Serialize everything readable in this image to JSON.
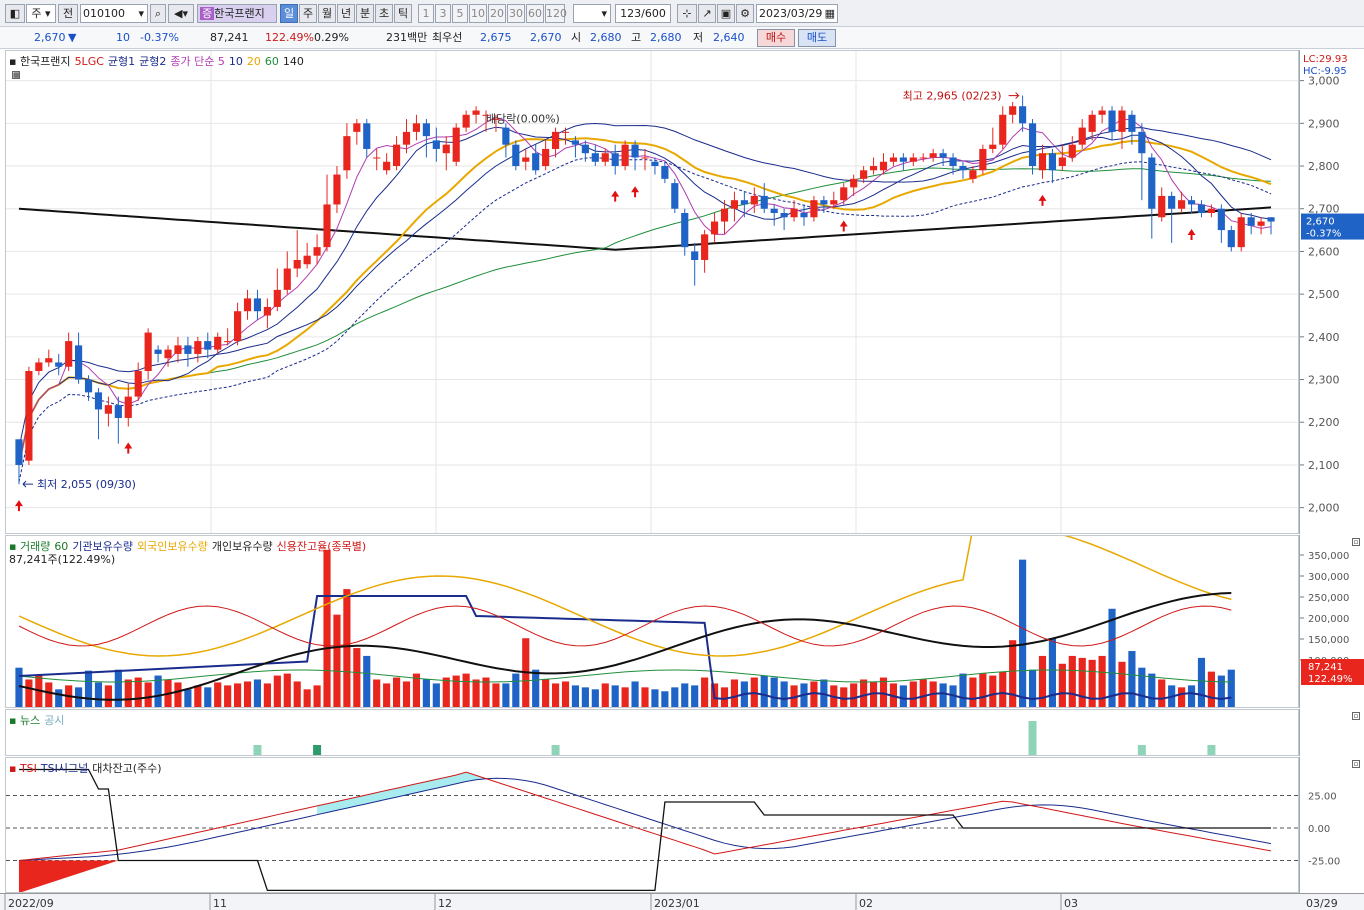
{
  "toolbar": {
    "period_label": "주",
    "prev_label": "전",
    "code_value": "010100",
    "stock_name": "한국프랜지",
    "chart_types": [
      "일",
      "주",
      "월",
      "년",
      "분",
      "초",
      "틱"
    ],
    "intervals": [
      "1",
      "3",
      "5",
      "10",
      "20",
      "30",
      "60",
      "120"
    ],
    "count_value": "123",
    "count_total": "/600",
    "date_value": "2023/03/29"
  },
  "quote": {
    "price": "2,670",
    "direction": "▼",
    "change": "10",
    "change_rate": "-0.37%",
    "volume": "87,241",
    "volume_ratio": "122.49%",
    "turnover_rate": "0.29%",
    "trade_amount": "231백만",
    "best_ask_label": "최우선",
    "best_ask": "2,675",
    "best_bid": "2,670",
    "open_label": "시",
    "open": "2,680",
    "high_label": "고",
    "high": "2,680",
    "low_label": "저",
    "low": "2,640",
    "buy_label": "매수",
    "sell_label": "매도"
  },
  "main_pane": {
    "legend": [
      {
        "text": "한국프랜지",
        "color": "#222222"
      },
      {
        "text": "5LGC",
        "color": "#d01818"
      },
      {
        "text": "균형1",
        "color": "#1a2c8c"
      },
      {
        "text": "균형2",
        "color": "#1a2c8c"
      },
      {
        "text": "종가 단순 5",
        "color": "#b23cb2"
      },
      {
        "text": "10",
        "color": "#1a2c8c"
      },
      {
        "text": "20",
        "color": "#e8a800"
      },
      {
        "text": "60",
        "color": "#1f8f3a"
      },
      {
        "text": "140",
        "color": "#222222"
      }
    ],
    "annotations": {
      "high": "최고 2,965 (02/23)",
      "low": "최저 2,055 (09/30)",
      "dividend": "배당락(0.00%)"
    },
    "lc_label": "LC:29.93",
    "hc_label": "HC:-9.95",
    "price_ticks": [
      "3,000",
      "2,900",
      "2,800",
      "2,700",
      "2,600",
      "2,500",
      "2,400",
      "2,300",
      "2,200",
      "2,100",
      "2,000"
    ],
    "current_price_tag": "2,670",
    "current_rate_tag": "-0.37%"
  },
  "volume_pane": {
    "legend": [
      {
        "text": "거래량",
        "color": "#1a7a2a"
      },
      {
        "text": "60",
        "color": "#1a7a2a"
      },
      {
        "text": "기관보유수량",
        "color": "#1a2c8c"
      },
      {
        "text": "외국인보유수량",
        "color": "#e8a800"
      },
      {
        "text": "개인보유수량",
        "color": "#222222"
      },
      {
        "text": "신용잔고율(종목별)",
        "color": "#d01818"
      }
    ],
    "sub_label": "87,241주(122.49%)",
    "ticks": [
      "350,000",
      "300,000",
      "250,000",
      "200,000",
      "150,000",
      "100,000"
    ],
    "current_volume_tag": "87,241",
    "current_ratio_tag": "122.49%"
  },
  "news_pane": {
    "legend": [
      {
        "text": "뉴스",
        "color": "#1a7a2a"
      },
      {
        "text": "공시",
        "color": "#7ab"
      }
    ]
  },
  "tsi_pane": {
    "legend": [
      {
        "text": "TSI",
        "color": "#d01818"
      },
      {
        "text": "TSI시그널",
        "color": "#1a2c8c"
      },
      {
        "text": "대차잔고(주수)",
        "color": "#222222"
      }
    ],
    "ticks": [
      "25.00",
      "0.00",
      "-25.00"
    ]
  },
  "time_axis": {
    "labels": [
      "2022/09",
      "11",
      "12",
      "2023/01",
      "02",
      "03"
    ],
    "end_label": "03/29"
  },
  "colors": {
    "up": "#e8261e",
    "down": "#1f63c6",
    "ma5": "#b23cb2",
    "ma10": "#1a2c8c",
    "ma20": "#e8a800",
    "ma60": "#1f8f3a",
    "ma140": "#111111"
  },
  "chart_data": {
    "type": "candlestick",
    "price_range": [
      1950,
      3060
    ],
    "candles": [
      [
        2160,
        2100,
        2160,
        2055
      ],
      [
        2110,
        2320,
        2330,
        2100
      ],
      [
        2320,
        2340,
        2350,
        2310
      ],
      [
        2340,
        2350,
        2370,
        2330
      ],
      [
        2340,
        2330,
        2360,
        2310
      ],
      [
        2330,
        2390,
        2410,
        2320
      ],
      [
        2380,
        2300,
        2410,
        2290
      ],
      [
        2300,
        2270,
        2310,
        2250
      ],
      [
        2270,
        2230,
        2280,
        2160
      ],
      [
        2220,
        2240,
        2260,
        2190
      ],
      [
        2240,
        2210,
        2260,
        2150
      ],
      [
        2210,
        2260,
        2290,
        2190
      ],
      [
        2260,
        2320,
        2340,
        2250
      ],
      [
        2320,
        2410,
        2420,
        2300
      ],
      [
        2370,
        2360,
        2380,
        2340
      ],
      [
        2350,
        2370,
        2380,
        2330
      ],
      [
        2360,
        2380,
        2400,
        2340
      ],
      [
        2380,
        2360,
        2400,
        2330
      ],
      [
        2360,
        2390,
        2400,
        2340
      ],
      [
        2390,
        2370,
        2410,
        2350
      ],
      [
        2370,
        2400,
        2410,
        2360
      ],
      [
        2390,
        2390,
        2420,
        2380
      ],
      [
        2390,
        2460,
        2480,
        2380
      ],
      [
        2460,
        2490,
        2510,
        2440
      ],
      [
        2490,
        2460,
        2510,
        2440
      ],
      [
        2450,
        2470,
        2490,
        2420
      ],
      [
        2470,
        2510,
        2560,
        2460
      ],
      [
        2510,
        2560,
        2600,
        2500
      ],
      [
        2560,
        2580,
        2650,
        2540
      ],
      [
        2570,
        2590,
        2620,
        2560
      ],
      [
        2590,
        2610,
        2640,
        2570
      ],
      [
        2610,
        2710,
        2780,
        2600
      ],
      [
        2710,
        2780,
        2800,
        2690
      ],
      [
        2790,
        2870,
        2900,
        2770
      ],
      [
        2880,
        2900,
        2910,
        2850
      ],
      [
        2900,
        2840,
        2910,
        2820
      ],
      [
        2820,
        2820,
        2840,
        2790
      ],
      [
        2790,
        2810,
        2830,
        2780
      ],
      [
        2800,
        2850,
        2870,
        2790
      ],
      [
        2850,
        2880,
        2910,
        2830
      ],
      [
        2880,
        2900,
        2920,
        2860
      ],
      [
        2900,
        2870,
        2910,
        2820
      ],
      [
        2860,
        2840,
        2890,
        2810
      ],
      [
        2830,
        2850,
        2870,
        2790
      ],
      [
        2810,
        2890,
        2900,
        2800
      ],
      [
        2890,
        2920,
        2930,
        2880
      ],
      [
        2920,
        2930,
        2940,
        2900
      ],
      [
        2920,
        2920,
        2930,
        2880
      ],
      [
        2910,
        2910,
        2920,
        2880
      ],
      [
        2890,
        2850,
        2900,
        2820
      ],
      [
        2850,
        2800,
        2860,
        2790
      ],
      [
        2810,
        2820,
        2840,
        2790
      ],
      [
        2830,
        2790,
        2850,
        2780
      ],
      [
        2800,
        2840,
        2860,
        2790
      ],
      [
        2840,
        2880,
        2890,
        2820
      ],
      [
        2880,
        2880,
        2890,
        2850
      ],
      [
        2860,
        2850,
        2870,
        2820
      ],
      [
        2850,
        2830,
        2860,
        2810
      ],
      [
        2830,
        2810,
        2850,
        2800
      ],
      [
        2810,
        2830,
        2840,
        2800
      ],
      [
        2830,
        2800,
        2850,
        2780
      ],
      [
        2800,
        2850,
        2860,
        2790
      ],
      [
        2850,
        2820,
        2860,
        2790
      ],
      [
        2820,
        2820,
        2840,
        2790
      ],
      [
        2810,
        2800,
        2820,
        2780
      ],
      [
        2800,
        2770,
        2810,
        2760
      ],
      [
        2760,
        2700,
        2770,
        2690
      ],
      [
        2690,
        2610,
        2700,
        2590
      ],
      [
        2600,
        2580,
        2620,
        2520
      ],
      [
        2580,
        2640,
        2650,
        2550
      ],
      [
        2640,
        2670,
        2690,
        2620
      ],
      [
        2670,
        2700,
        2720,
        2640
      ],
      [
        2700,
        2720,
        2740,
        2670
      ],
      [
        2720,
        2710,
        2740,
        2680
      ],
      [
        2710,
        2730,
        2750,
        2690
      ],
      [
        2730,
        2700,
        2760,
        2690
      ],
      [
        2700,
        2690,
        2710,
        2660
      ],
      [
        2690,
        2680,
        2700,
        2650
      ],
      [
        2680,
        2700,
        2720,
        2670
      ],
      [
        2690,
        2680,
        2710,
        2660
      ],
      [
        2680,
        2720,
        2730,
        2670
      ],
      [
        2720,
        2710,
        2730,
        2690
      ],
      [
        2710,
        2720,
        2740,
        2700
      ],
      [
        2720,
        2750,
        2760,
        2710
      ],
      [
        2750,
        2770,
        2780,
        2730
      ],
      [
        2770,
        2790,
        2800,
        2760
      ],
      [
        2790,
        2800,
        2820,
        2780
      ],
      [
        2790,
        2810,
        2830,
        2780
      ],
      [
        2810,
        2820,
        2830,
        2800
      ],
      [
        2820,
        2810,
        2830,
        2790
      ],
      [
        2810,
        2820,
        2830,
        2800
      ],
      [
        2820,
        2820,
        2830,
        2810
      ],
      [
        2820,
        2830,
        2840,
        2810
      ],
      [
        2830,
        2820,
        2840,
        2800
      ],
      [
        2820,
        2800,
        2830,
        2780
      ],
      [
        2800,
        2790,
        2810,
        2770
      ],
      [
        2770,
        2790,
        2800,
        2760
      ],
      [
        2790,
        2840,
        2850,
        2780
      ],
      [
        2840,
        2850,
        2890,
        2830
      ],
      [
        2850,
        2920,
        2940,
        2840
      ],
      [
        2920,
        2940,
        2950,
        2900
      ],
      [
        2940,
        2900,
        2965,
        2880
      ],
      [
        2900,
        2800,
        2910,
        2780
      ],
      [
        2790,
        2830,
        2850,
        2770
      ],
      [
        2830,
        2790,
        2840,
        2760
      ],
      [
        2800,
        2820,
        2850,
        2790
      ],
      [
        2820,
        2850,
        2870,
        2810
      ],
      [
        2850,
        2890,
        2910,
        2840
      ],
      [
        2880,
        2920,
        2930,
        2860
      ],
      [
        2920,
        2930,
        2940,
        2900
      ],
      [
        2930,
        2880,
        2940,
        2860
      ],
      [
        2880,
        2930,
        2940,
        2840
      ],
      [
        2920,
        2880,
        2930,
        2850
      ],
      [
        2880,
        2830,
        2900,
        2720
      ],
      [
        2820,
        2700,
        2830,
        2630
      ],
      [
        2680,
        2730,
        2750,
        2670
      ],
      [
        2730,
        2700,
        2740,
        2620
      ],
      [
        2700,
        2720,
        2740,
        2690
      ],
      [
        2720,
        2710,
        2730,
        2690
      ],
      [
        2710,
        2690,
        2720,
        2680
      ],
      [
        2690,
        2700,
        2710,
        2680
      ],
      [
        2700,
        2650,
        2710,
        2620
      ],
      [
        2650,
        2610,
        2660,
        2600
      ],
      [
        2610,
        2680,
        2690,
        2600
      ],
      [
        2680,
        2660,
        2690,
        2640
      ],
      [
        2660,
        2670,
        2680,
        2640
      ],
      [
        2680,
        2670,
        2680,
        2640
      ]
    ],
    "volume": [
      40,
      28,
      33,
      25,
      18,
      22,
      20,
      37,
      25,
      22,
      38,
      28,
      30,
      25,
      32,
      28,
      25,
      18,
      22,
      20,
      25,
      22,
      24,
      26,
      28,
      24,
      32,
      34,
      26,
      18,
      22,
      160,
      94,
      120,
      60,
      52,
      28,
      24,
      30,
      26,
      34,
      28,
      24,
      30,
      32,
      34,
      28,
      30,
      24,
      24,
      34,
      70,
      38,
      28,
      24,
      26,
      22,
      20,
      18,
      24,
      22,
      20,
      26,
      20,
      18,
      16,
      20,
      24,
      22,
      30,
      24,
      20,
      28,
      26,
      30,
      32,
      30,
      26,
      22,
      24,
      26,
      28,
      22,
      20,
      24,
      28,
      26,
      30,
      24,
      22,
      26,
      28,
      26,
      24,
      22,
      34,
      30,
      34,
      32,
      36,
      68,
      150,
      38,
      52,
      70,
      44,
      52,
      50,
      48,
      52,
      100,
      46,
      57,
      40,
      34,
      28,
      22,
      20,
      22,
      50,
      36,
      32,
      38
    ],
    "tsi_ticks": [
      25,
      0,
      -25
    ]
  }
}
